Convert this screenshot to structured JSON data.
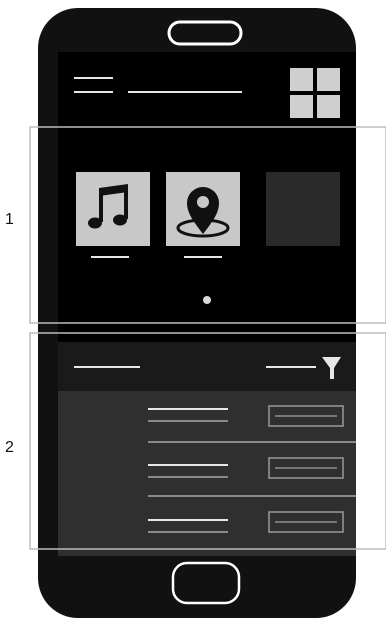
{
  "callouts": [
    {
      "label": "1"
    },
    {
      "label": "2"
    }
  ],
  "colors": {
    "phone_body": "#111111",
    "screen_top": "#000000",
    "toolbar": "#1a1a1a",
    "list_area": "#2f2f2f",
    "tile_light": "#c8c8c8",
    "tile_dark": "#2a2a2a",
    "line": "#e6e6e6",
    "callout_border": "#bdbdbd"
  },
  "icons": {
    "menu": "hamburger-menu-icon",
    "grid": "grid-view-icon",
    "music": "music-note-icon",
    "location": "location-pin-icon",
    "filter": "filter-funnel-icon",
    "home": "home-button-icon",
    "speaker": "earpiece-speaker-icon"
  },
  "carousel": {
    "tiles": 3,
    "active_page_dots": 1
  },
  "list": {
    "rows": 3
  }
}
